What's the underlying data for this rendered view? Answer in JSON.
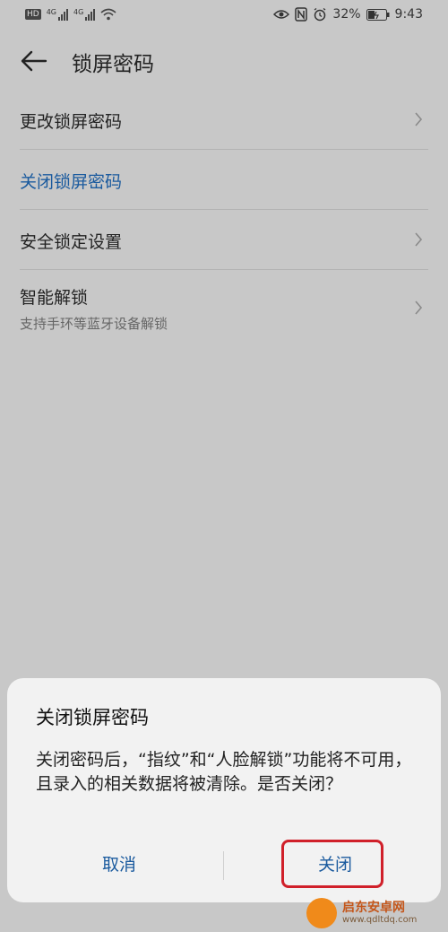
{
  "status_bar": {
    "hd": "HD",
    "sim1": "4G",
    "sim2": "4G",
    "battery": "32%",
    "time": "9:43",
    "icons": [
      "eye-icon",
      "nfc-icon",
      "alarm-icon",
      "battery-icon"
    ]
  },
  "header": {
    "title": "锁屏密码"
  },
  "list": {
    "items": [
      {
        "label": "更改锁屏密码",
        "subtitle": "",
        "has_chevron": true
      },
      {
        "label": "关闭锁屏密码",
        "subtitle": "",
        "has_chevron": false
      },
      {
        "label": "安全锁定设置",
        "subtitle": "",
        "has_chevron": true
      },
      {
        "label": "智能解锁",
        "subtitle": "支持手环等蓝牙设备解锁",
        "has_chevron": true
      }
    ]
  },
  "dialog": {
    "title": "关闭锁屏密码",
    "message": "关闭密码后，“指纹”和“人脸解锁”功能将不可用，且录入的相关数据将被清除。是否关闭？",
    "cancel_label": "取消",
    "confirm_label": "关闭"
  },
  "watermark": {
    "name": "启东安卓网",
    "url": "www.qdltdq.com"
  },
  "colors": {
    "accent": "#1a5a9e",
    "highlight": "#d0202a"
  }
}
